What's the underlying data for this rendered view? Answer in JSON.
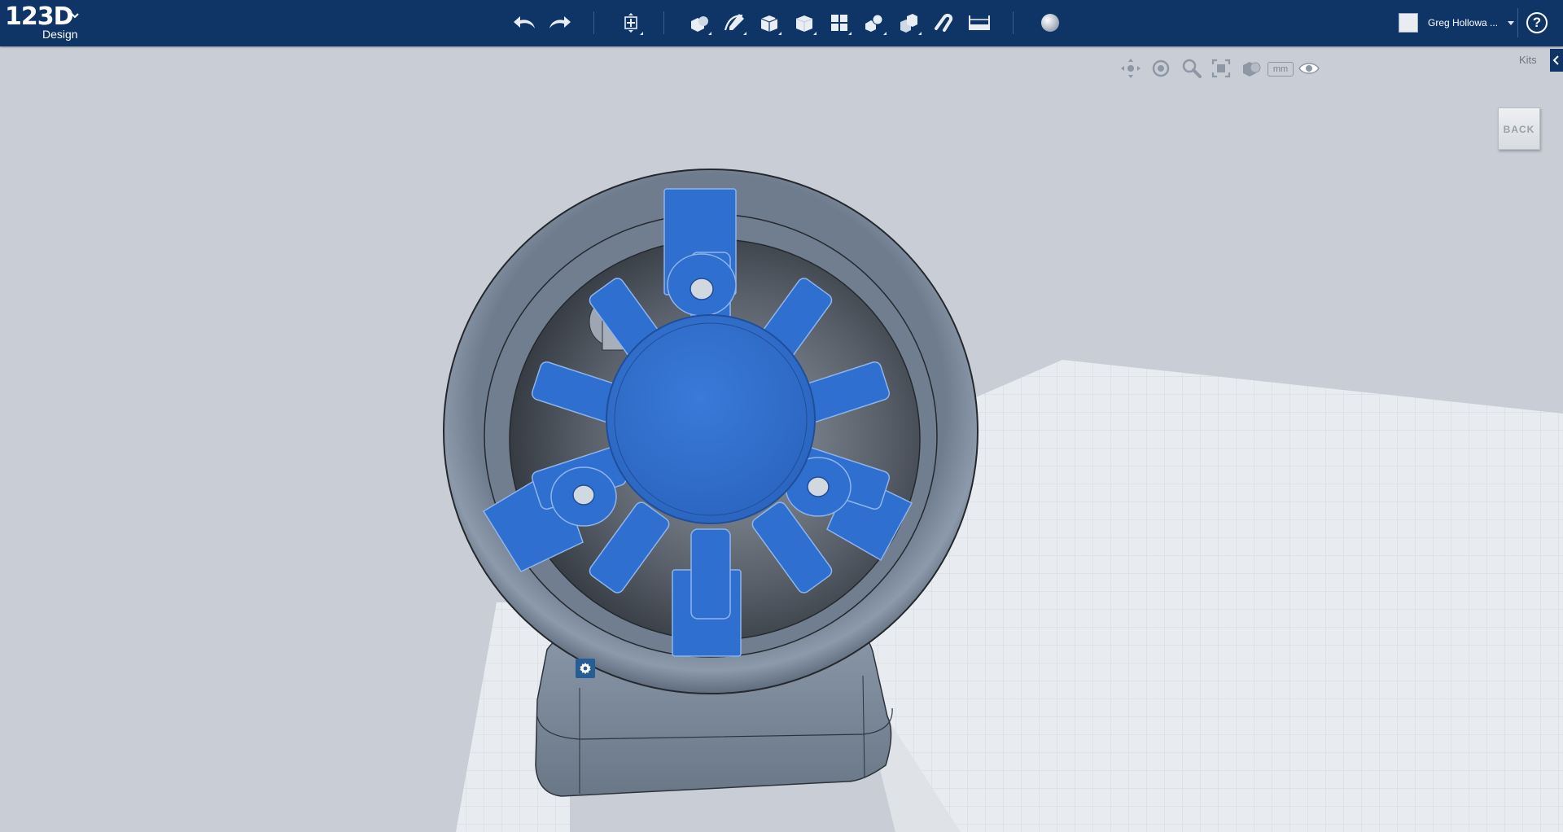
{
  "app": {
    "logo_main": "123D",
    "logo_sub": "Design"
  },
  "toolbar": {
    "tools": [
      {
        "name": "undo-icon"
      },
      {
        "name": "redo-icon"
      },
      {
        "name": "transform-icon"
      },
      {
        "name": "primitives-icon"
      },
      {
        "name": "sketch-icon"
      },
      {
        "name": "construct-icon"
      },
      {
        "name": "modify-icon"
      },
      {
        "name": "pattern-icon"
      },
      {
        "name": "grouping-icon"
      },
      {
        "name": "combine-icon"
      },
      {
        "name": "snap-icon"
      },
      {
        "name": "measure-icon"
      },
      {
        "name": "material-icon"
      }
    ]
  },
  "user": {
    "name": "Greg Hollowa ..."
  },
  "help_label": "?",
  "nav": {
    "tools": [
      "pan-icon",
      "orbit-icon",
      "zoom-icon",
      "fit-icon",
      "visual-style-icon"
    ],
    "units": "mm"
  },
  "kits_label": "Kits",
  "viewcube_label": "BACK",
  "colors": {
    "topbar": "#0e3566",
    "selection": "#2f6fd0",
    "model": "#7d8b9c",
    "background": "#c9ced6",
    "grid": "#e8ebef"
  }
}
